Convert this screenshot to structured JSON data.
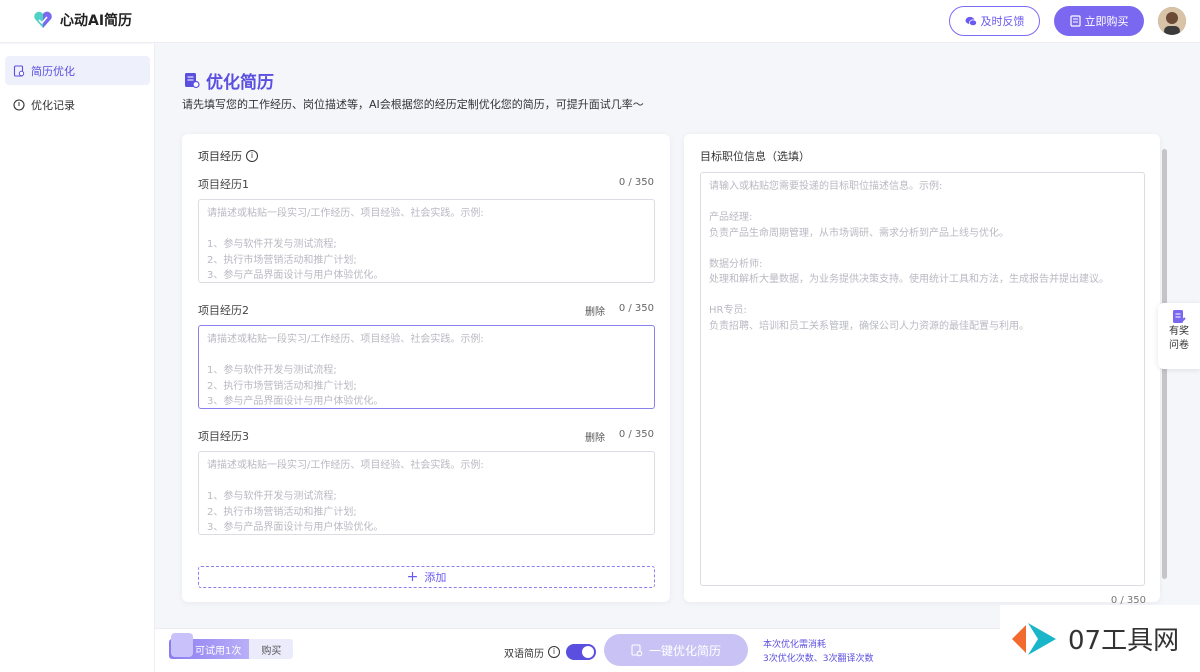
{
  "header": {
    "brand": "心动AI简历",
    "feedback_label": "及时反馈",
    "buy_label": "立即购买"
  },
  "sidebar": {
    "items": [
      {
        "label": "简历优化",
        "icon": "resume-icon",
        "active": true
      },
      {
        "label": "优化记录",
        "icon": "record-icon",
        "active": false
      }
    ]
  },
  "page": {
    "title": "优化简历",
    "description": "请先填写您的工作经历、岗位描述等，AI会根据您的经历定制优化您的简历，可提升面试几率～"
  },
  "projects": {
    "heading": "项目经历",
    "delete_label": "删除",
    "placeholder": "请描述或粘贴一段实习/工作经历、项目经验、社会实践。示例:\n\n1、参与软件开发与测试流程;\n2、执行市场营销活动和推广计划;\n3、参与产品界面设计与用户体验优化。",
    "items": [
      {
        "label": "项目经历1",
        "count": "0 / 350"
      },
      {
        "label": "项目经历2",
        "count": "0 / 350"
      },
      {
        "label": "项目经历3",
        "count": "0 / 350"
      }
    ],
    "add_label": "添加"
  },
  "target": {
    "heading": "目标职位信息（选填）",
    "placeholder": "请输入或粘贴您需要投递的目标职位描述信息。示例:\n\n产品经理:\n负责产品生命周期管理，从市场调研、需求分析到产品上线与优化。\n\n数据分析师:\n处理和解析大量数据，为业务提供决策支持。使用统计工具和方法，生成报告并提出建议。\n\nHR专员:\n负责招聘、培训和员工关系管理，确保公司人力资源的最佳配置与利用。",
    "count": "0 / 350"
  },
  "survey": {
    "line1": "有奖",
    "line2": "问卷"
  },
  "bottom": {
    "trial_label": "可试用1次",
    "buy_label": "购买",
    "bilingual_label": "双语简历",
    "optimize_label": "一键优化简历",
    "cost_line1": "本次优化需消耗",
    "cost_line2": "3次优化次数、3次翻译次数"
  },
  "watermark": {
    "text": "07工具网"
  },
  "colors": {
    "accent": "#5b4fe0",
    "accent_light": "#c9c3f5"
  }
}
